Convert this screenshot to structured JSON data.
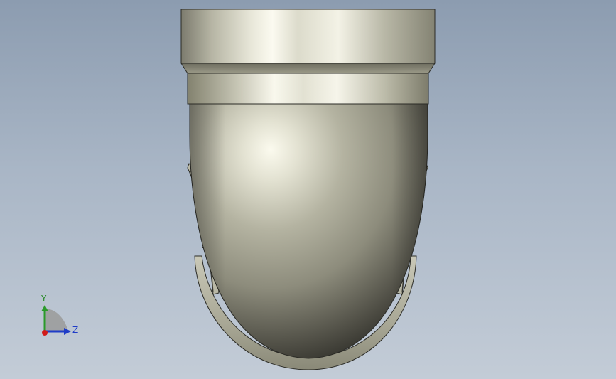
{
  "window": {
    "background_top": "#8c9cb0",
    "background_bottom": "#c3ccd7"
  },
  "model": {
    "part": "pipe-elbow",
    "body_color": "#b7b6a6",
    "highlight_color": "#f7f6ea",
    "shadow_color": "#1a1a16",
    "edge_color": "#2b2b26"
  },
  "triad": {
    "y_label": "Y",
    "z_label": "Z",
    "y_color": "#2a9a2a",
    "z_color": "#1f3cc7",
    "x_color": "#d11a1a",
    "plane_color": "#9a9a9a"
  }
}
